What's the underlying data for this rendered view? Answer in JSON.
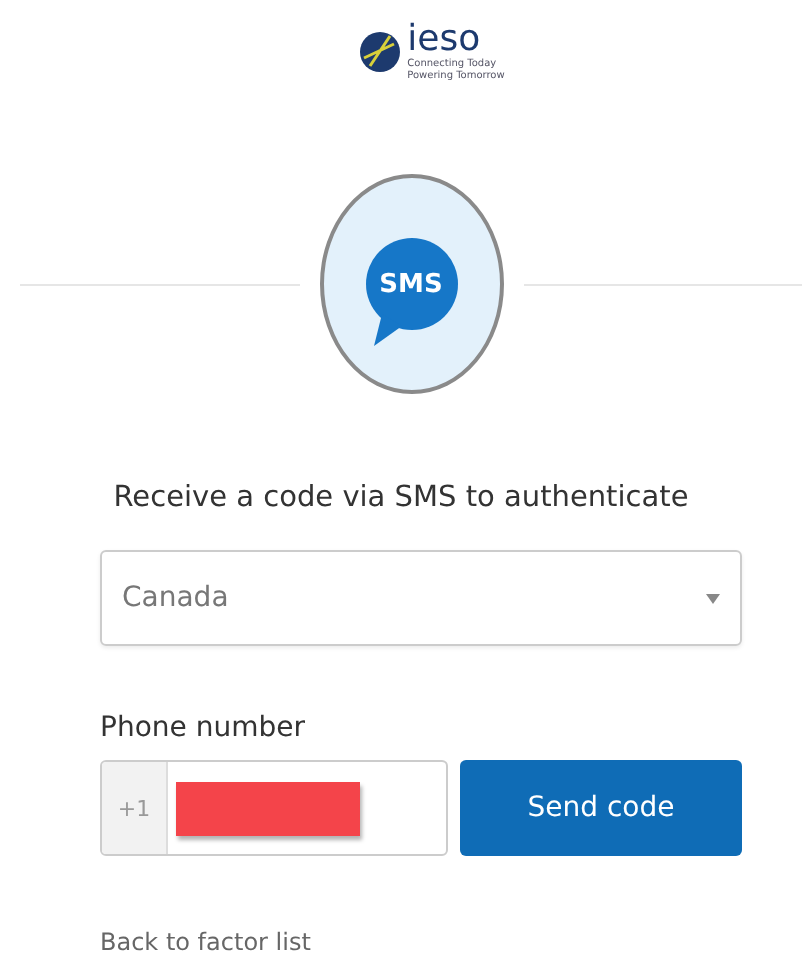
{
  "logo": {
    "name": "ieso",
    "tagline_1": "Connecting Today",
    "tagline_2": "Powering Tomorrow"
  },
  "factor_badge": {
    "label": "SMS"
  },
  "heading": "Receive a code via SMS to authenticate",
  "country_select": {
    "value": "Canada"
  },
  "phone": {
    "label": "Phone number",
    "prefix": "+1",
    "redacted": true
  },
  "send_button": {
    "label": "Send code"
  },
  "back_link": "Back to factor list"
}
